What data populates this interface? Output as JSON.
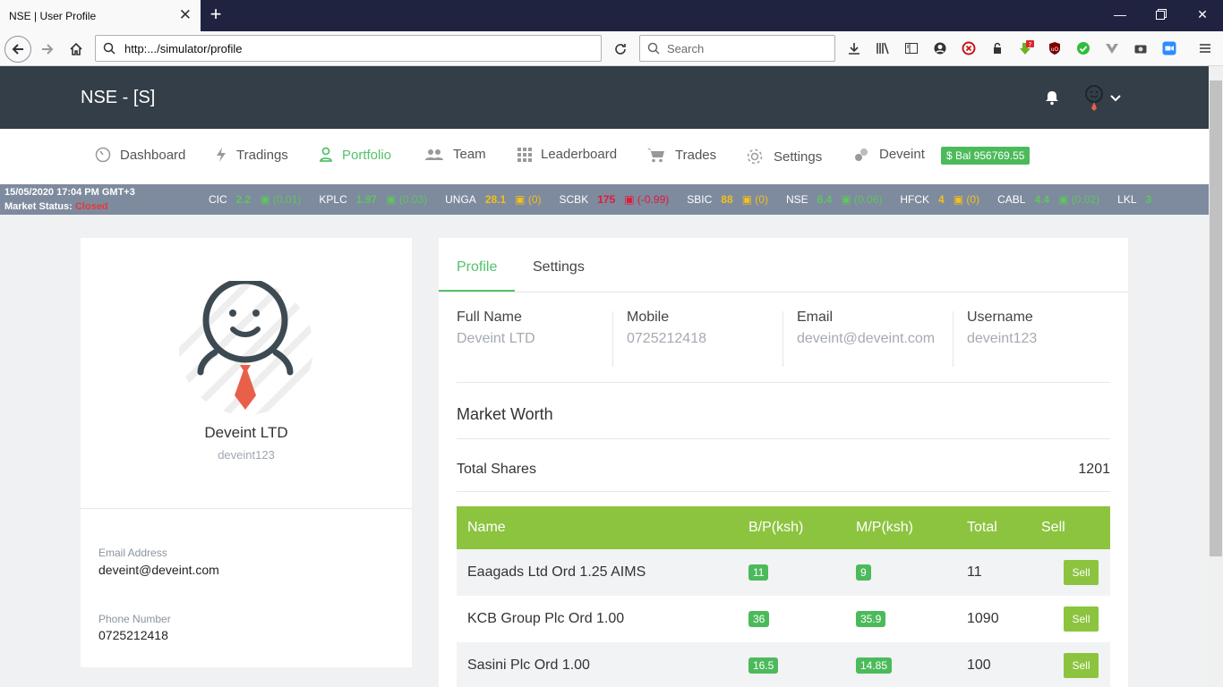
{
  "browser": {
    "tab_title": "NSE | User Profile",
    "url": "http:.../simulator/profile",
    "search_placeholder": "Search",
    "ext_badge": "?"
  },
  "site": {
    "brand": "NSE - [S]"
  },
  "nav": {
    "items": [
      "Dashboard",
      "Tradings",
      "Portfolio",
      "Team",
      "Leaderboard",
      "Trades",
      "Settings",
      "Deveint"
    ],
    "active": "Portfolio",
    "balance": "$ Bal 956769.55"
  },
  "ticker": {
    "datetime": "15/05/2020 17:04 PM GMT+3",
    "status_label": "Market Status:",
    "status_value": "Closed",
    "items": [
      {
        "symbol": "CIC",
        "price": "2.2",
        "change": "▣ (0.01)",
        "dir": "up"
      },
      {
        "symbol": "KPLC",
        "price": "1.97",
        "change": "▣ (0.03)",
        "dir": "up"
      },
      {
        "symbol": "UNGA",
        "price": "28.1",
        "change": "▣ (0)",
        "dir": "flat"
      },
      {
        "symbol": "SCBK",
        "price": "175",
        "change": "▣ (-0.99)",
        "dir": "down"
      },
      {
        "symbol": "SBIC",
        "price": "88",
        "change": "▣ (0)",
        "dir": "flat"
      },
      {
        "symbol": "NSE",
        "price": "6.4",
        "change": "▣ (0.06)",
        "dir": "up"
      },
      {
        "symbol": "HFCK",
        "price": "4",
        "change": "▣ (0)",
        "dir": "flat"
      },
      {
        "symbol": "CABL",
        "price": "4.4",
        "change": "▣ (0.02)",
        "dir": "up"
      },
      {
        "symbol": "LKL",
        "price": "3",
        "change": "",
        "dir": "up"
      }
    ]
  },
  "profile_card": {
    "name": "Deveint LTD",
    "username": "deveint123",
    "email_label": "Email Address",
    "email": "deveint@deveint.com",
    "phone_label": "Phone Number",
    "phone": "0725212418"
  },
  "panel": {
    "tabs": [
      "Profile",
      "Settings"
    ],
    "info": [
      {
        "label": "Full Name",
        "value": "Deveint LTD"
      },
      {
        "label": "Mobile",
        "value": "0725212418"
      },
      {
        "label": "Email",
        "value": "deveint@deveint.com"
      },
      {
        "label": "Username",
        "value": "deveint123"
      }
    ],
    "market_worth": "Market Worth",
    "total_shares_label": "Total Shares",
    "total_shares": "1201",
    "table": {
      "headers": [
        "Name",
        "B/P(ksh)",
        "M/P(ksh)",
        "Total",
        "Sell"
      ],
      "rows": [
        {
          "name": "Eaagads Ltd Ord 1.25 AIMS",
          "bp": "11",
          "mp": "9",
          "total": "11",
          "sell": "Sell"
        },
        {
          "name": "KCB Group Plc Ord 1.00",
          "bp": "36",
          "mp": "35.9",
          "total": "1090",
          "sell": "Sell"
        },
        {
          "name": "Sasini Plc Ord 1.00",
          "bp": "16.5",
          "mp": "14.85",
          "total": "100",
          "sell": "Sell"
        }
      ]
    }
  },
  "colors": {
    "accent": "#53c26b",
    "header": "#343e48",
    "table_header": "#8cc43f",
    "ticker_bg": "#7e8a9e"
  }
}
